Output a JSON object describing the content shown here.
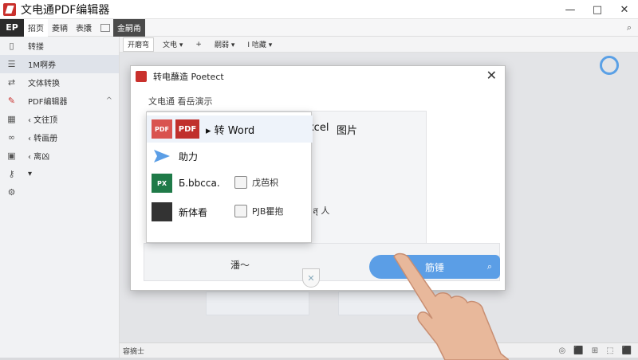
{
  "app": {
    "title": "文电通PDF编辑器",
    "logo_text": "EP",
    "window_controls": [
      "—",
      "□",
      "✕"
    ]
  },
  "menubar": {
    "items": [
      "招页",
      "菱辆",
      "表攮",
      "金嗣甬"
    ]
  },
  "sidebar": {
    "items": [
      {
        "label": "转搂",
        "icon": "document-icon"
      },
      {
        "label": "1M啊券",
        "icon": "list-icon"
      },
      {
        "label": "文体转换",
        "icon": "convert-icon"
      },
      {
        "label": "PDF编辑器",
        "icon": "pen-icon"
      },
      {
        "label": "‹ 文往顶",
        "icon": "grid-icon"
      },
      {
        "label": "‹ 转画册",
        "icon": "link-icon"
      },
      {
        "label": "‹ 离凶",
        "icon": "lock-icon"
      },
      {
        "label": "▾",
        "icon": "key-icon"
      },
      {
        "label": "",
        "icon": "gear-icon"
      }
    ]
  },
  "toolbar": {
    "items": [
      "开磨弯",
      "文电 ▾",
      "+",
      "嗣弱 ▾",
      "I 唁藏 ▾"
    ]
  },
  "dialog": {
    "title": "转电蘸造 Poetect",
    "subtitle": "文电通 看岳演示",
    "excel_label": "Excel",
    "picture_label": "图片",
    "hint": "ก.สุ 人",
    "bottom_label": "潘～",
    "primary_button": "筋锤"
  },
  "dropdown": {
    "pdf_small": "PDF",
    "pdf_big": "PDF",
    "to_word": "▸ 转 Word",
    "help": "助力",
    "ppt_label": "Б.bbcca.",
    "doc_label": "新体看",
    "check1_label": "戊芭枳",
    "check2_label": "PJB瞿抱",
    "excel_icon": "Excel"
  },
  "statusbar": {
    "left": "容摘士",
    "right": [
      "◎",
      "⬛",
      "⊞",
      "⬚",
      "⬛"
    ]
  }
}
